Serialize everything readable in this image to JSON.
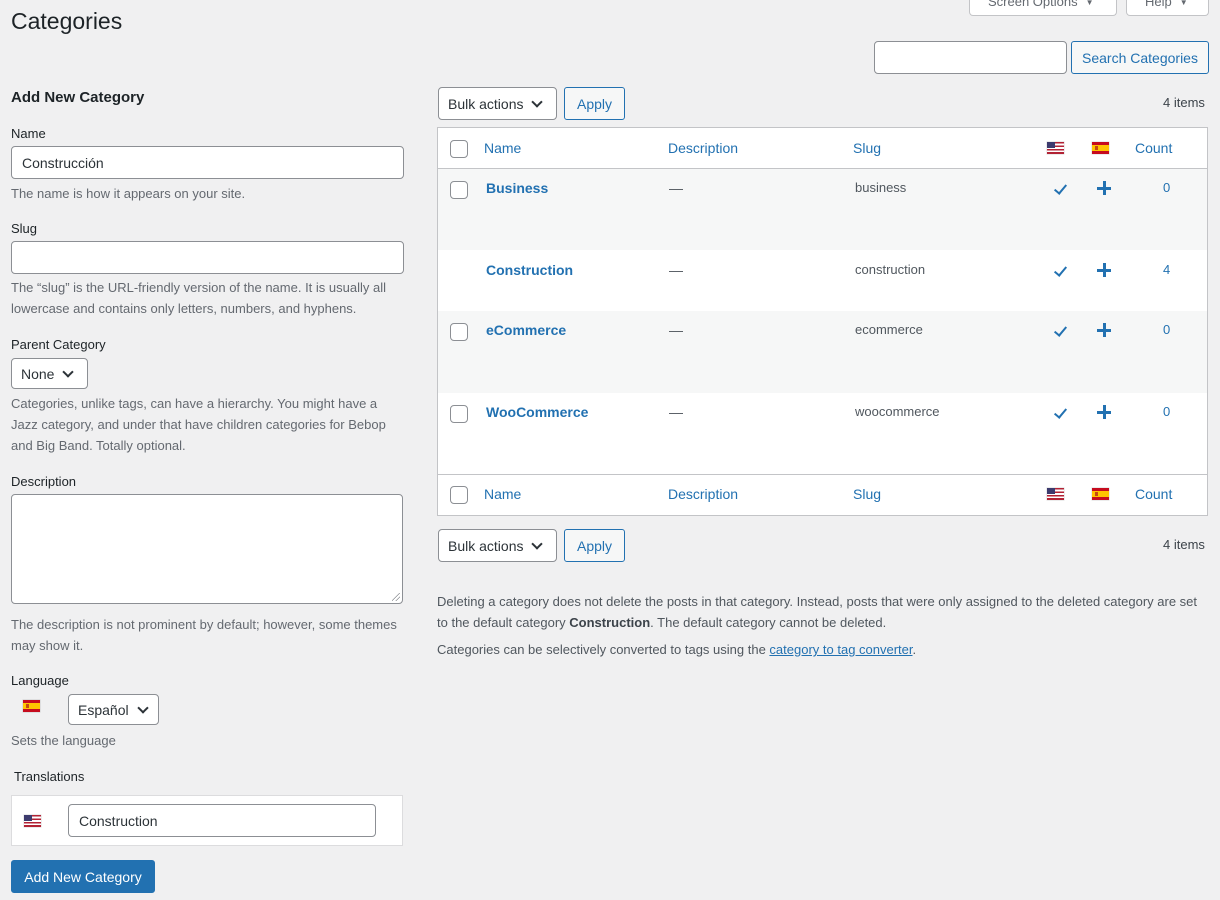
{
  "header": {
    "title": "Categories",
    "screen_options": "Screen Options",
    "help": "Help"
  },
  "search": {
    "value": "",
    "button": "Search Categories"
  },
  "form": {
    "title": "Add New Category",
    "name_label": "Name",
    "name_value": "Construcción",
    "name_help": "The name is how it appears on your site.",
    "slug_label": "Slug",
    "slug_value": "",
    "slug_help": "The “slug” is the URL-friendly version of the name. It is usually all lowercase and contains only letters, numbers, and hyphens.",
    "parent_label": "Parent Category",
    "parent_value": "None",
    "parent_help": "Categories, unlike tags, can have a hierarchy. You might have a Jazz category, and under that have children categories for Bebop and Big Band. Totally optional.",
    "description_label": "Description",
    "description_help": "The description is not prominent by default; however, some themes may show it.",
    "language_label": "Language",
    "language_value": "Español",
    "language_help": "Sets the language",
    "translations_label": "Translations",
    "translation_value": "Construction",
    "submit": "Add New Category"
  },
  "toolbar": {
    "bulk_actions": "Bulk actions",
    "apply": "Apply",
    "items": "4 items"
  },
  "table": {
    "columns": {
      "name": "Name",
      "description": "Description",
      "slug": "Slug",
      "count": "Count"
    },
    "rows": [
      {
        "name": "Business",
        "description": "—",
        "slug": "business",
        "count": "0"
      },
      {
        "name": "Construction",
        "description": "—",
        "slug": "construction",
        "count": "4"
      },
      {
        "name": "eCommerce",
        "description": "—",
        "slug": "ecommerce",
        "count": "0"
      },
      {
        "name": "WooCommerce",
        "description": "—",
        "slug": "woocommerce",
        "count": "0"
      }
    ]
  },
  "notes": {
    "delete_text_1": "Deleting a category does not delete the posts in that category. Instead, posts that were only assigned to the deleted category are set to the default category ",
    "default_category": "Construction",
    "delete_text_2": ". The default category cannot be deleted.",
    "convert_text": "Categories can be selectively converted to tags using the ",
    "convert_link": "category to tag converter",
    "convert_end": "."
  },
  "icons": {
    "flag_en": "us-flag-icon",
    "flag_es": "spain-flag-icon",
    "check": "checkmark-icon",
    "add": "plus-icon"
  },
  "colors": {
    "accent": "#2271b1",
    "background": "#f0f0f1"
  }
}
